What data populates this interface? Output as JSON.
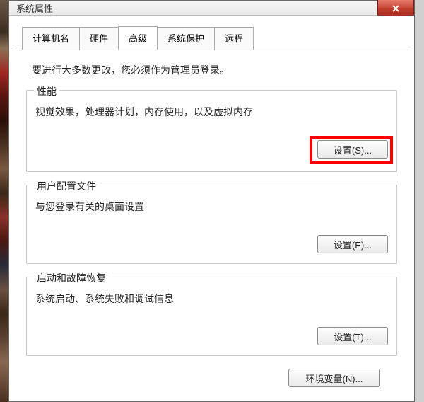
{
  "window": {
    "title": "系统属性"
  },
  "tabs": {
    "computer_name": "计算机名",
    "hardware": "硬件",
    "advanced": "高级",
    "system_protection": "系统保护",
    "remote": "远程"
  },
  "main": {
    "intro": "要进行大多数更改，您必须作为管理员登录。"
  },
  "performance": {
    "title": "性能",
    "desc": "视觉效果，处理器计划，内存使用，以及虚拟内存",
    "button": "设置(S)..."
  },
  "user_profiles": {
    "title": "用户配置文件",
    "desc": "与您登录有关的桌面设置",
    "button": "设置(E)..."
  },
  "startup_recovery": {
    "title": "启动和故障恢复",
    "desc": "系统启动、系统失败和调试信息",
    "button": "设置(T)..."
  },
  "env_vars": {
    "button": "环境变量(N)..."
  }
}
